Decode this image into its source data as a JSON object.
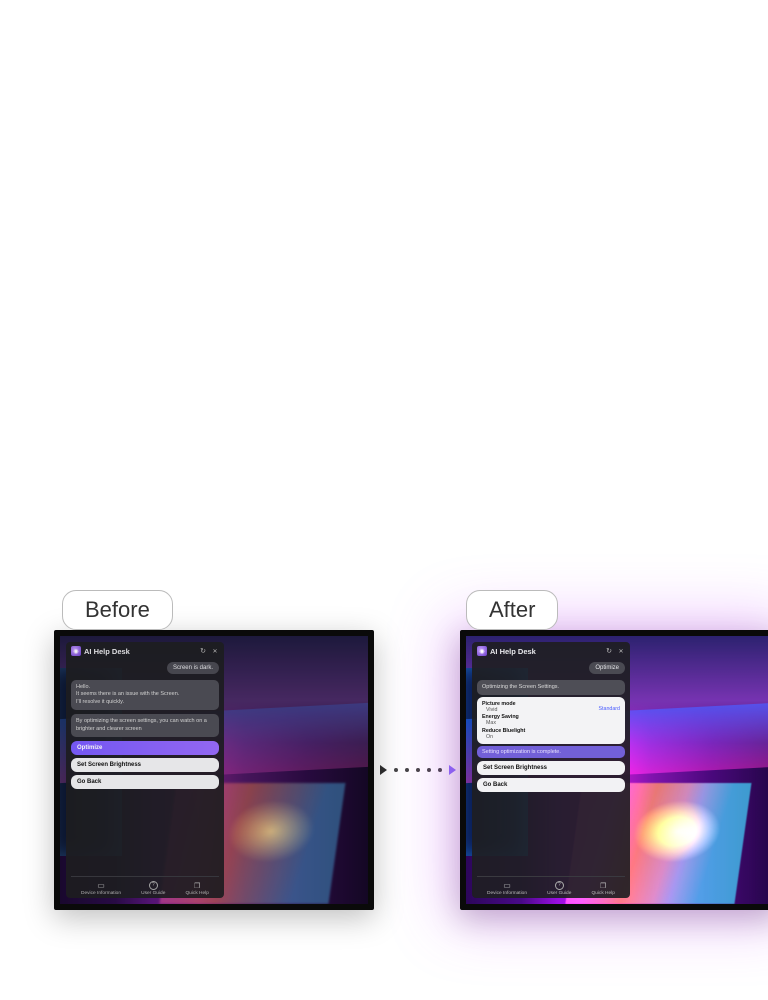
{
  "labels": {
    "before": "Before",
    "after": "After"
  },
  "panel": {
    "title": "AI Help Desk",
    "footer": [
      {
        "label": "Device Information"
      },
      {
        "label": "User Guide"
      },
      {
        "label": "Quick Help"
      }
    ]
  },
  "before": {
    "user_msg": "Screen is dark.",
    "sys_msg_1": "Hello.\nIt seems there is an issue with the Screen.\nI'll resolve it quickly.",
    "sys_msg_2": "By optimizing the screen settings, you can watch on a brighter and clearer screen",
    "buttons": {
      "optimize": "Optimize",
      "brightness": "Set Screen Brightness",
      "back": "Go Back"
    }
  },
  "after": {
    "user_msg": "Optimize",
    "sys_msg_1": "Optimizing the Screen Settings.",
    "settings": {
      "picture_mode": {
        "label": "Picture mode",
        "value": "Vivid",
        "new_value": "Standard"
      },
      "energy_saving": {
        "label": "Energy Saving",
        "value": "Max"
      },
      "reduce_bluelight": {
        "label": "Reduce Bluelight",
        "value": "On"
      }
    },
    "status": "Setting optimization is complete.",
    "buttons": {
      "brightness": "Set Screen Brightness",
      "back": "Go Back"
    }
  }
}
